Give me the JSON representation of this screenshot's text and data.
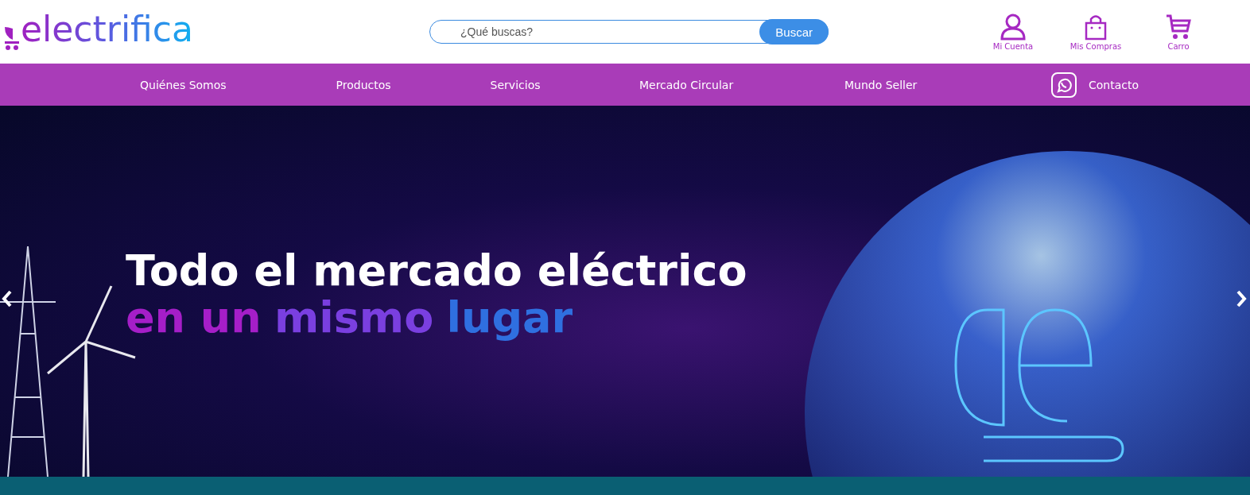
{
  "header": {
    "logo": "electrifica",
    "search": {
      "placeholder": "¿Qué buscas?",
      "button": "Buscar"
    },
    "actions": [
      {
        "kind": "account",
        "label": "Mi Cuenta"
      },
      {
        "kind": "bag",
        "label": "Mis Compras"
      },
      {
        "kind": "cart",
        "label": "Carro"
      }
    ]
  },
  "nav": {
    "items": [
      "Quiénes Somos",
      "Productos",
      "Servicios",
      "Mercado Circular",
      "Mundo Seller"
    ],
    "contact": "Contacto"
  },
  "hero": {
    "line_1": "Todo el mercado eléctrico",
    "line_2": [
      {
        "text": "en un",
        "color": "#a51ec8"
      },
      {
        "text": "mismo",
        "color": "#7a3fe0"
      },
      {
        "text": "lugar",
        "color": "#2f6fe0"
      }
    ]
  }
}
